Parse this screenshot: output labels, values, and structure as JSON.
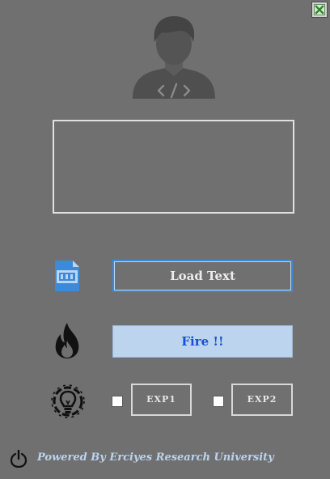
{
  "window": {
    "close_icon": "close-x-icon"
  },
  "avatar": {
    "icon": "developer-avatar-icon"
  },
  "input": {
    "value": "",
    "placeholder": ""
  },
  "actions": {
    "load_label": "Load Text",
    "load_icon": "file-icon",
    "fire_label": "Fire !!",
    "fire_icon": "fire-icon"
  },
  "experiments": {
    "icon": "lightbulb-gear-icon",
    "exp1_label": "EXP1",
    "exp1_checked": false,
    "exp2_label": "EXP2",
    "exp2_checked": false
  },
  "footer": {
    "power_icon": "power-icon",
    "text": "Powered By Erciyes Research University"
  },
  "colors": {
    "background": "#707070",
    "accent_blue": "#3c8ad8",
    "fire_button_bg": "#bcd4ee",
    "fire_button_text": "#1b4fd3",
    "footer_text": "#bcd2ec",
    "close_green": "#2a8a2a"
  }
}
